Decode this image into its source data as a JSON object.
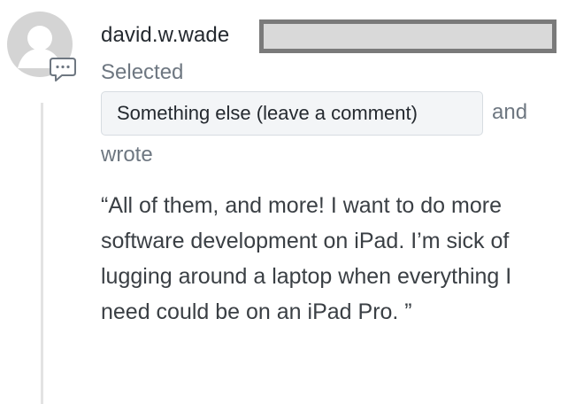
{
  "comment": {
    "username": "david.w.wade",
    "selected_label": "Selected",
    "choice": "Something else (leave a comment)",
    "and_label": "and",
    "wrote_label": "wrote",
    "quote": "“All of them, and more! I want to do more software development on iPad. I’m sick of lugging around a laptop when everything I need could be on an iPad Pro. ”"
  },
  "icons": {
    "avatar": "default-avatar-icon",
    "comment": "comment-bubble-icon"
  }
}
